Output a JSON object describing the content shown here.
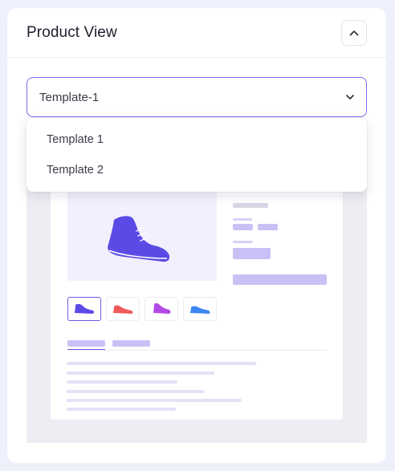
{
  "panel": {
    "title": "Product View"
  },
  "template_select": {
    "value": "Template-1",
    "options": [
      "Template 1",
      "Template 2"
    ]
  },
  "icons": {
    "collapse": "chevron-up-icon",
    "dropdown": "chevron-down-icon",
    "shoe": "sneaker-icon"
  },
  "colors": {
    "accent": "#6a5de8",
    "placeholder_bar": "#c8c1f5",
    "line": "#e6e6f3",
    "thumb_shoes": [
      "#5b4be6",
      "#ef5a5a",
      "#b24be6",
      "#3a85f0"
    ]
  }
}
